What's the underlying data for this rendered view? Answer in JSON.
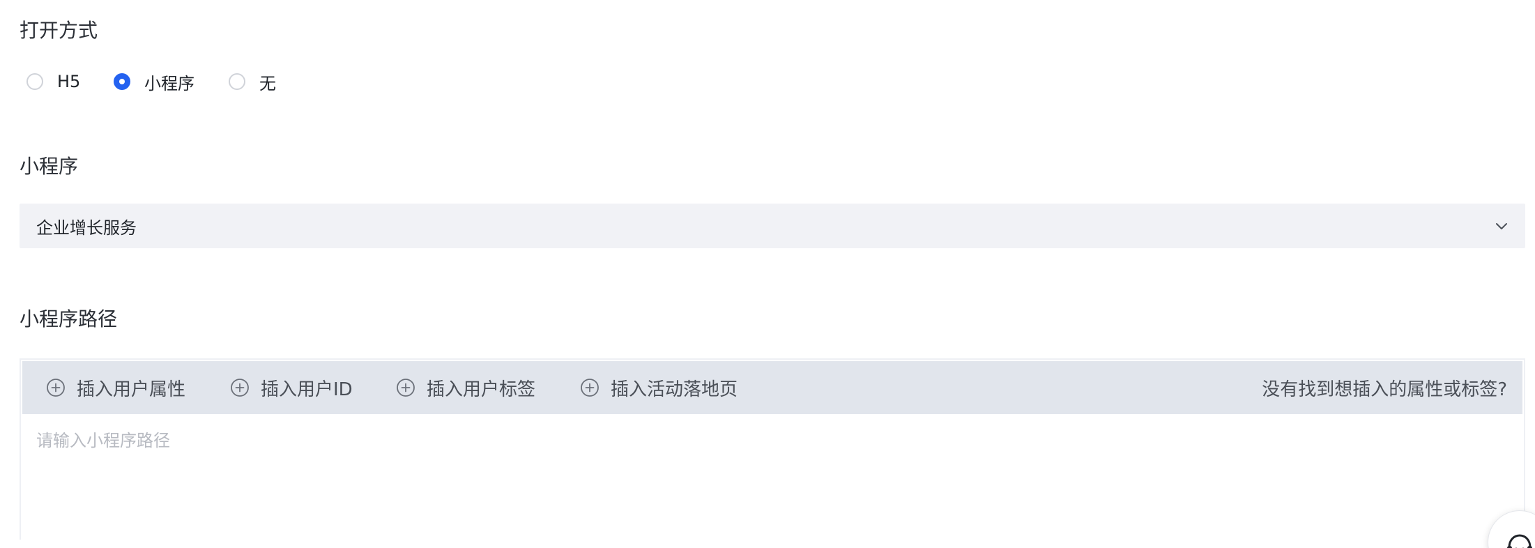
{
  "open_mode": {
    "label": "打开方式",
    "options": [
      {
        "label": "H5",
        "checked": false
      },
      {
        "label": "小程序",
        "checked": true
      },
      {
        "label": "无",
        "checked": false
      }
    ]
  },
  "mini_program": {
    "label": "小程序",
    "selected_value": "企业增长服务",
    "icon": "chevron-down-icon"
  },
  "mini_program_path": {
    "label": "小程序路径",
    "toolbar": {
      "insert_user_attribute": "插入用户属性",
      "insert_user_id": "插入用户ID",
      "insert_user_tag": "插入用户标签",
      "insert_activity_landing_page": "插入活动落地页",
      "help_link": "没有找到想插入的属性或标签?"
    },
    "input": {
      "value": "",
      "placeholder": "请输入小程序路径"
    }
  },
  "colors": {
    "accent": "#2462f0",
    "select_bg": "#f1f2f6",
    "toolbar_bg": "#e1e5ec",
    "placeholder": "#b7bac1"
  },
  "icons": [
    "plus-circle-icon",
    "chevron-down-icon",
    "customer-service-icon"
  ]
}
